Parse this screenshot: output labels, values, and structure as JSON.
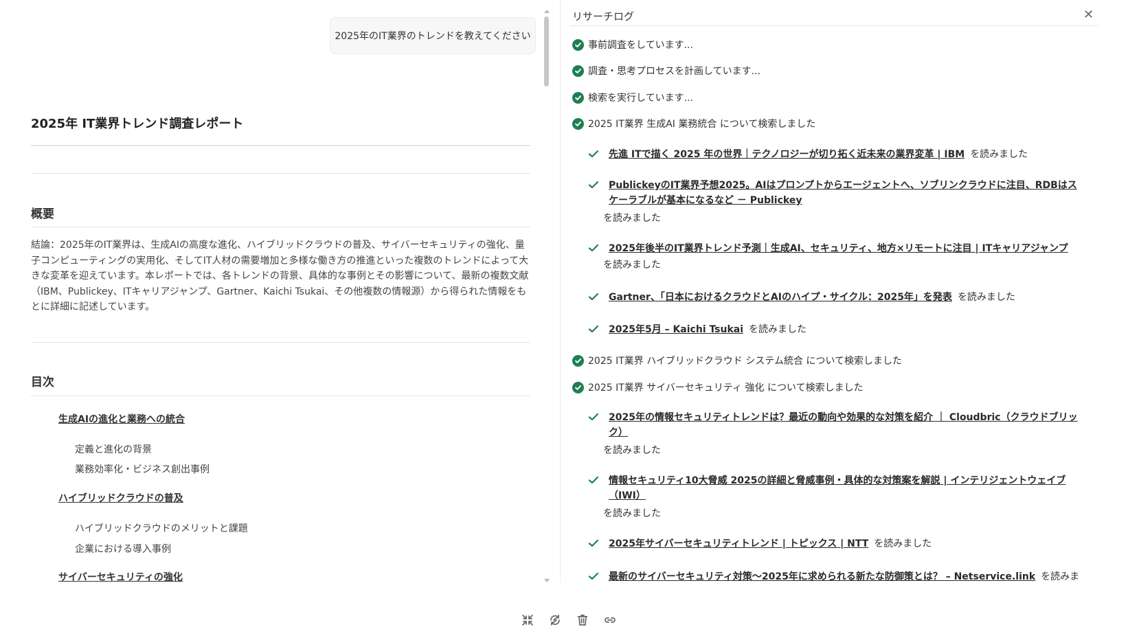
{
  "chat": {
    "user_message": "2025年のIT業界のトレンドを教えてください"
  },
  "report": {
    "title": "2025年 IT業界トレンド調査レポート",
    "summary_heading": "概要",
    "summary_text": "結論：2025年のIT業界は、生成AIの高度な進化、ハイブリッドクラウドの普及、サイバーセキュリティの強化、量子コンピューティングの実用化、そしてIT人材の需要増加と多様な働き方の推進といった複数のトレンドによって大きな変革を迎えています。本レポートでは、各トレンドの背景、具体的な事例とその影響について、最新の複数文献（IBM、Publickey、ITキャリアジャンプ、Gartner、Kaichi Tsukai、その他複数の情報源）から得られた情報をもとに詳細に記述しています。",
    "toc_heading": "目次",
    "toc": [
      {
        "label": "生成AIの進化と業務への統合",
        "children": [
          "定義と進化の背景",
          "業務効率化・ビジネス創出事例"
        ]
      },
      {
        "label": "ハイブリッドクラウドの普及",
        "children": [
          "ハイブリッドクラウドのメリットと課題",
          "企業における導入事例"
        ]
      },
      {
        "label": "サイバーセキュリティの強化",
        "children": []
      }
    ]
  },
  "research_log": {
    "title": "リサーチログ",
    "close_icon": "close-icon",
    "read_suffix": "を読みました",
    "steps": [
      {
        "type": "status",
        "text": "事前調査をしています..."
      },
      {
        "type": "status",
        "text": "調査・思考プロセスを計画しています..."
      },
      {
        "type": "status",
        "text": "検索を実行しています..."
      },
      {
        "type": "search",
        "text": "2025 IT業界 生成AI 業務統合 について検索しました"
      },
      {
        "type": "read",
        "link": "先進 ITで描く 2025 年の世界｜テクノロジーが切り拓く近未来の業界変革 | IBM"
      },
      {
        "type": "read",
        "link": "PublickeyのIT業界予想2025。AIはプロンプトからエージェントへ、ソブリンクラウドに注目、RDBはスケーラブルが基本になるなど － Publickey"
      },
      {
        "type": "read",
        "link": "2025年後半のIT業界トレンド予測｜生成AI、セキュリティ、地方×リモートに注目 | ITキャリアジャンプ"
      },
      {
        "type": "read",
        "link": "Gartner、「日本におけるクラウドとAIのハイプ・サイクル：2025年」を発表"
      },
      {
        "type": "read",
        "link": "2025年5月 – Kaichi Tsukai"
      },
      {
        "type": "search",
        "text": "2025 IT業界 ハイブリッドクラウド システム統合 について検索しました"
      },
      {
        "type": "search",
        "text": "2025 IT業界 サイバーセキュリティ 強化 について検索しました"
      },
      {
        "type": "read",
        "link": "2025年の情報セキュリティトレンドは？最近の動向や効果的な対策を紹介 ｜ Cloudbric（クラウドブリック）"
      },
      {
        "type": "read",
        "link": "情報セキュリティ10大脅威 2025の詳細と脅威事例・具体的な対策案を解説 | インテリジェントウェイブ（IWI）"
      },
      {
        "type": "read",
        "link": "2025年サイバーセキュリティトレンド | トピックス | NTT"
      },
      {
        "type": "read",
        "link": "最新のサイバーセキュリティ対策～2025年に求められる新たな防御策とは？ – Netservice.link"
      }
    ]
  },
  "toolbar": {
    "buttons": [
      "collapse-icon",
      "regenerate-icon",
      "delete-icon",
      "link-icon"
    ]
  },
  "colors": {
    "check_green": "#1e7f53",
    "text": "#2b2b2b"
  }
}
